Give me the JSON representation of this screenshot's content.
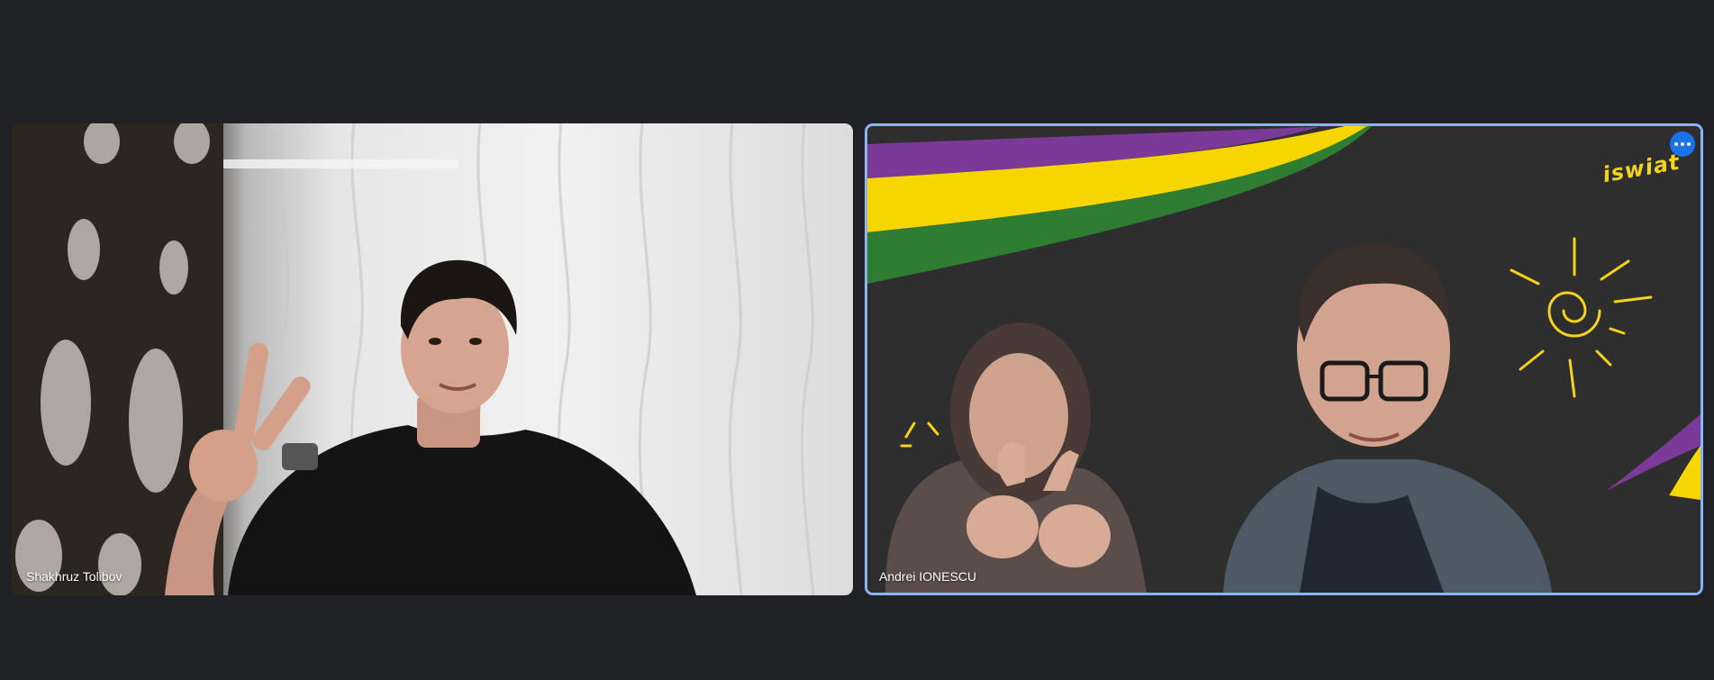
{
  "participants": [
    {
      "name": "Shakhruz Tolibov"
    },
    {
      "name": "Andrei IONESCU"
    }
  ],
  "active_tile": {
    "highlight_color": "#8ab4f8",
    "more_options_icon": "more-horizontal-icon"
  },
  "background_branding": {
    "logo": "iswiat",
    "stripe_colors": [
      "#7b3a98",
      "#f7d600",
      "#2e7d32"
    ]
  },
  "theme": {
    "page_background": "#202124",
    "accent": "#1a73e8"
  }
}
